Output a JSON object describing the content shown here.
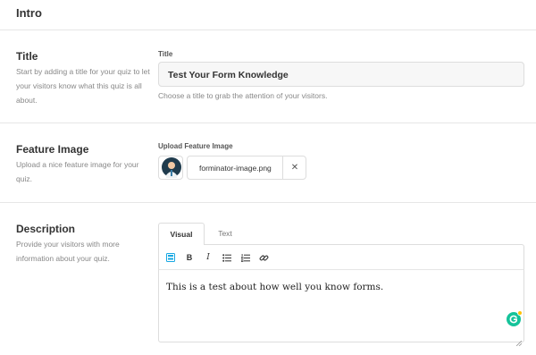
{
  "header": {
    "title": "Intro"
  },
  "title_section": {
    "label": "Title",
    "description": "Start by adding a title for your quiz to let your visitors know what this quiz is all about.",
    "field_label": "Title",
    "value": "Test Your Form Knowledge",
    "help": "Choose a title to grab the attention of your visitors."
  },
  "image_section": {
    "label": "Feature Image",
    "description": "Upload a nice feature image for your quiz.",
    "field_label": "Upload Feature Image",
    "file_name": "forminator-image.png",
    "remove_icon": "close-icon",
    "remove_glyph": "✕"
  },
  "description_section": {
    "label": "Description",
    "description": "Provide your visitors with more information about your quiz.",
    "tabs": [
      "Visual",
      "Text"
    ],
    "active_tab": "Visual",
    "toolbar": [
      {
        "name": "kitchen-sink-icon",
        "glyph": "▤",
        "color": "#17a8e3"
      },
      {
        "name": "bold-icon",
        "glyph": "B",
        "color": "#333333"
      },
      {
        "name": "italic-icon",
        "glyph": "I",
        "color": "#333333"
      },
      {
        "name": "bulleted-list-icon",
        "glyph": "☰",
        "color": "#333333"
      },
      {
        "name": "numbered-list-icon",
        "glyph": "☷",
        "color": "#333333"
      },
      {
        "name": "link-icon",
        "glyph": "🔗",
        "color": "#333333"
      }
    ],
    "content": "This is a test about how well you know forms.",
    "grammarly_icon": "grammarly-icon"
  },
  "colors": {
    "accent": "#17a8e3",
    "grammarly": "#15c39a"
  }
}
